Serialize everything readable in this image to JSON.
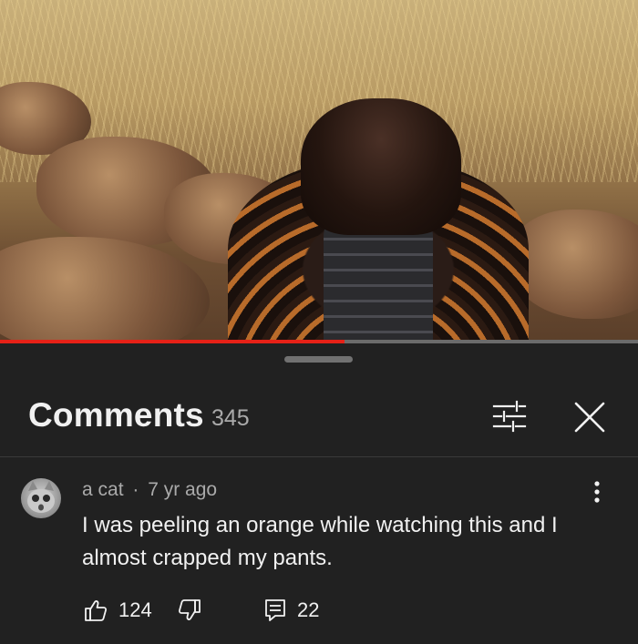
{
  "video": {
    "progress_fraction": 0.54
  },
  "panel": {
    "title": "Comments",
    "count": "345",
    "icons": {
      "filter": "sort-filter-icon",
      "close": "close-icon"
    }
  },
  "comment": {
    "author": "a cat",
    "separator": "·",
    "age": "7 yr ago",
    "text": "I was peeling an orange while watching this and I almost crapped my pants.",
    "likes": "124",
    "replies": "22",
    "icons": {
      "like": "thumbs-up-icon",
      "dislike": "thumbs-down-icon",
      "reply": "reply-icon",
      "more": "more-vertical-icon"
    }
  },
  "colors": {
    "background": "#212121",
    "progress": "#e62117",
    "secondary_text": "#aaaaaa"
  }
}
